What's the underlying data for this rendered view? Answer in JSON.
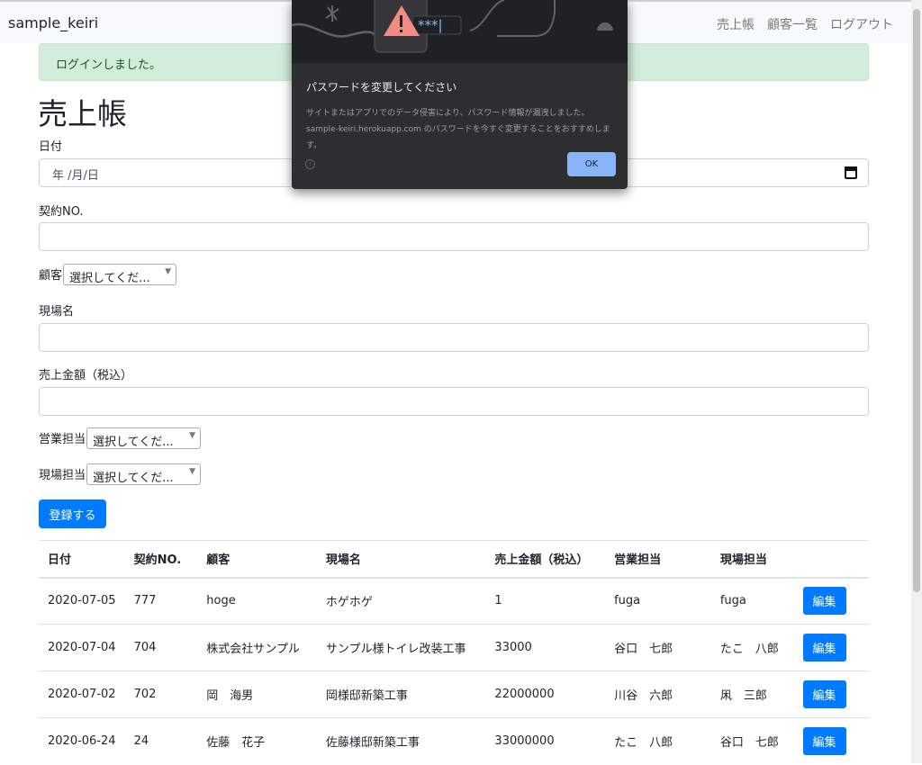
{
  "navbar": {
    "brand": "sample_keiri",
    "links": [
      "売上帳",
      "顧客一覧",
      "ログアウト"
    ]
  },
  "alert": {
    "message": "ログインしました。"
  },
  "page": {
    "title": "売上帳"
  },
  "form": {
    "date_label": "日付",
    "date_placeholder": "年 /月/日",
    "contract_label": "契約NO.",
    "customer_label": "顧客",
    "site_label": "現場名",
    "amount_label": "売上金額（税込）",
    "sales_rep_label": "営業担当",
    "site_rep_label": "現場担当",
    "select_placeholder": "選択してくだ...",
    "submit_label": "登録する"
  },
  "table": {
    "headers": [
      "日付",
      "契約NO.",
      "顧客",
      "現場名",
      "売上金額（税込）",
      "営業担当",
      "現場担当"
    ],
    "edit_label": "編集",
    "rows": [
      [
        "2020-07-05",
        "777",
        "hoge",
        "ホゲホゲ",
        "1",
        "fuga",
        "fuga"
      ],
      [
        "2020-07-04",
        "704",
        "株式会社サンプル",
        "サンプル様トイレ改装工事",
        "33000",
        "谷口　七郎",
        "たこ　八郎"
      ],
      [
        "2020-07-02",
        "702",
        "岡　海男",
        "岡様邸新築工事",
        "22000000",
        "川谷　六郎",
        "凩　三郎"
      ],
      [
        "2020-06-24",
        "24",
        "佐藤　花子",
        "佐藤様邸新築工事",
        "33000000",
        "たこ　八郎",
        "谷口　七郎"
      ]
    ]
  },
  "dialog": {
    "masked_password": "***|",
    "heading": "パスワードを変更してください",
    "body": "サイトまたはアプリでのデータ侵害により、パスワード情報が漏洩しました。sample-keiri.herokuapp.com のパスワードを今すぐ変更することをおすすめします。",
    "ok_label": "OK"
  },
  "colors": {
    "primary": "#007bff",
    "alert_bg": "#d4edda",
    "alert_text": "#155724",
    "dialog_bg": "#2d2e30",
    "dialog_button": "#8ab4f8",
    "warning_red": "#f28b82"
  }
}
